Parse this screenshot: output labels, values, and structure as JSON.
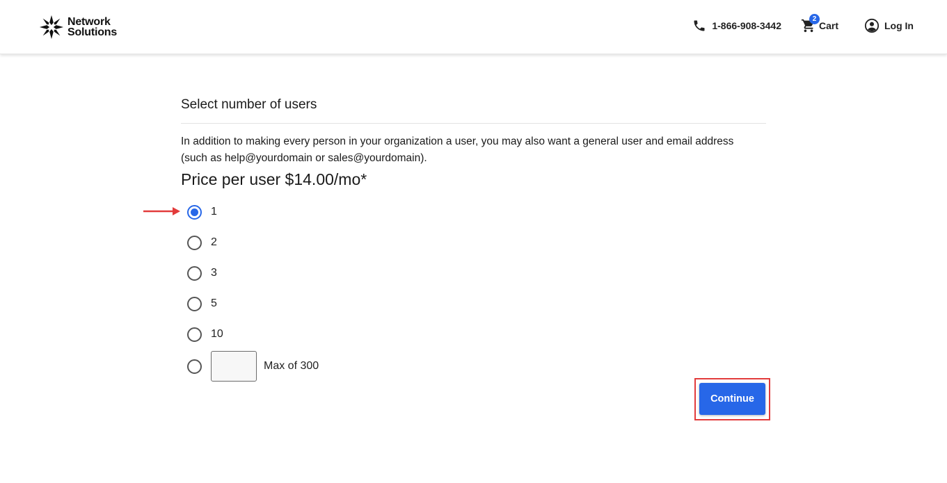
{
  "header": {
    "brand_line1": "Network",
    "brand_line2": "Solutions",
    "phone": "1-866-908-3442",
    "cart_label": "Cart",
    "cart_count": "2",
    "login_label": "Log In"
  },
  "main": {
    "title": "Select number of users",
    "description": "In addition to making every person in your organization a user, you may also want a general user and email address (such as help@yourdomain or sales@yourdomain).",
    "price": "Price per user $14.00/mo*",
    "options": [
      {
        "label": "1",
        "checked": true
      },
      {
        "label": "2",
        "checked": false
      },
      {
        "label": "3",
        "checked": false
      },
      {
        "label": "5",
        "checked": false
      },
      {
        "label": "10",
        "checked": false
      }
    ],
    "custom_option": {
      "value": "",
      "max_label": "Max of 300"
    },
    "continue_label": "Continue"
  },
  "colors": {
    "accent": "#2767e8",
    "annotation": "#e23b3b"
  }
}
